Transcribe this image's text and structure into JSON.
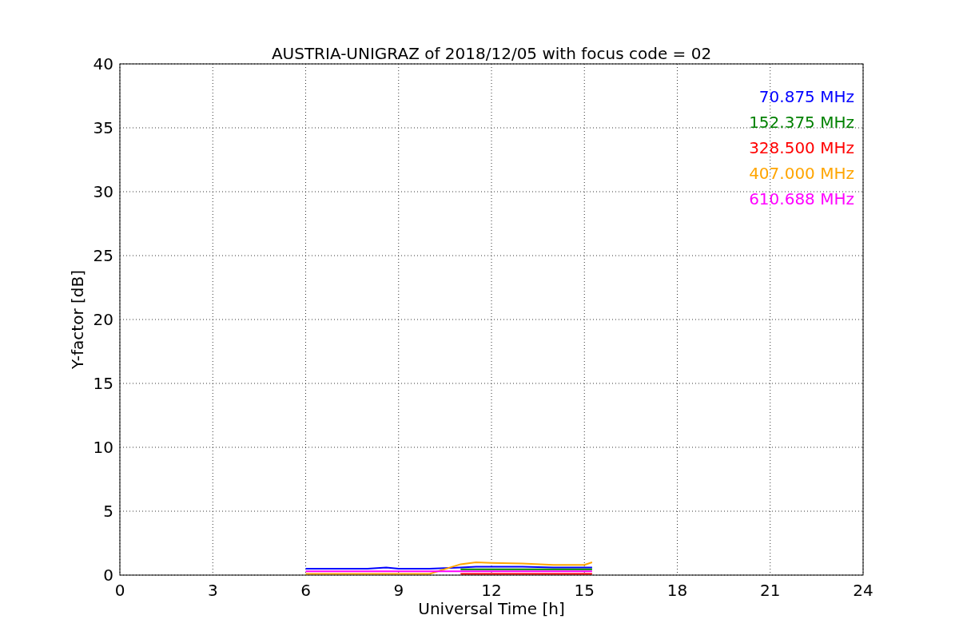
{
  "chart_data": {
    "type": "line",
    "title": "AUSTRIA-UNIGRAZ of 2018/12/05 with focus code = 02",
    "xlabel": "Universal Time [h]",
    "ylabel": "Y-factor [dB]",
    "x": [
      6,
      7,
      8,
      8.6,
      9,
      10,
      11,
      11.5,
      12,
      13,
      14,
      15,
      15.25
    ],
    "series": [
      {
        "name": "70.875 MHz",
        "color": "#0000ff",
        "values": [
          0.5,
          0.5,
          0.5,
          0.6,
          0.5,
          0.5,
          0.6,
          0.65,
          0.65,
          0.65,
          0.6,
          0.6,
          0.6
        ]
      },
      {
        "name": "152.375 MHz",
        "color": "#008000",
        "values": [
          null,
          null,
          null,
          null,
          null,
          null,
          0.45,
          0.45,
          0.45,
          0.45,
          0.45,
          0.45,
          0.45
        ]
      },
      {
        "name": "328.500 MHz",
        "color": "#ff0000",
        "values": [
          null,
          null,
          null,
          null,
          null,
          null,
          0.1,
          0.1,
          0.1,
          0.1,
          0.1,
          0.1,
          0.1
        ]
      },
      {
        "name": "407.000 MHz",
        "color": "#ffa500",
        "values": [
          0.1,
          0.1,
          0.1,
          0.1,
          0.1,
          0.1,
          0.85,
          1.0,
          0.95,
          0.9,
          0.8,
          0.8,
          1.0
        ]
      },
      {
        "name": "610.688 MHz",
        "color": "#ff00ff",
        "values": [
          0.3,
          0.3,
          0.3,
          0.3,
          0.3,
          0.3,
          0.3,
          0.3,
          0.3,
          0.3,
          0.3,
          0.3,
          0.3
        ]
      }
    ],
    "grid": true,
    "xlim": [
      0,
      24
    ],
    "ylim": [
      0,
      40
    ],
    "xticks": [
      0,
      3,
      6,
      9,
      12,
      15,
      18,
      21,
      24
    ],
    "yticks": [
      0,
      5,
      10,
      15,
      20,
      25,
      30,
      35,
      40
    ]
  }
}
